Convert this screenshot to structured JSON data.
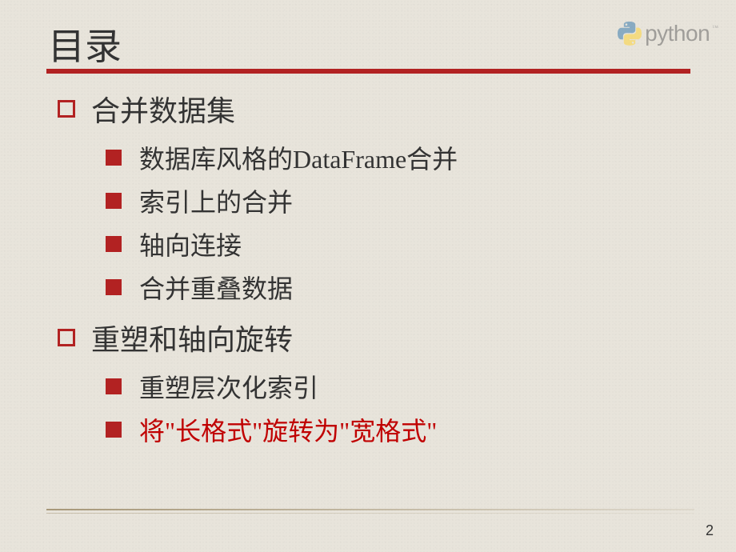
{
  "logo": {
    "text": "python",
    "tm": "™"
  },
  "icons": {
    "python": "python-logo-icon"
  },
  "title": "目录",
  "sections": [
    {
      "heading": "合并数据集",
      "items": [
        {
          "text": "数据库风格的DataFrame合并",
          "highlight": false
        },
        {
          "text": "索引上的合并",
          "highlight": false
        },
        {
          "text": "轴向连接",
          "highlight": false
        },
        {
          "text": "合并重叠数据",
          "highlight": false
        }
      ]
    },
    {
      "heading": "重塑和轴向旋转",
      "items": [
        {
          "text": "重塑层次化索引",
          "highlight": false
        },
        {
          "text": "将\"长格式\"旋转为\"宽格式\"",
          "highlight": true
        }
      ]
    }
  ],
  "page_number": "2"
}
